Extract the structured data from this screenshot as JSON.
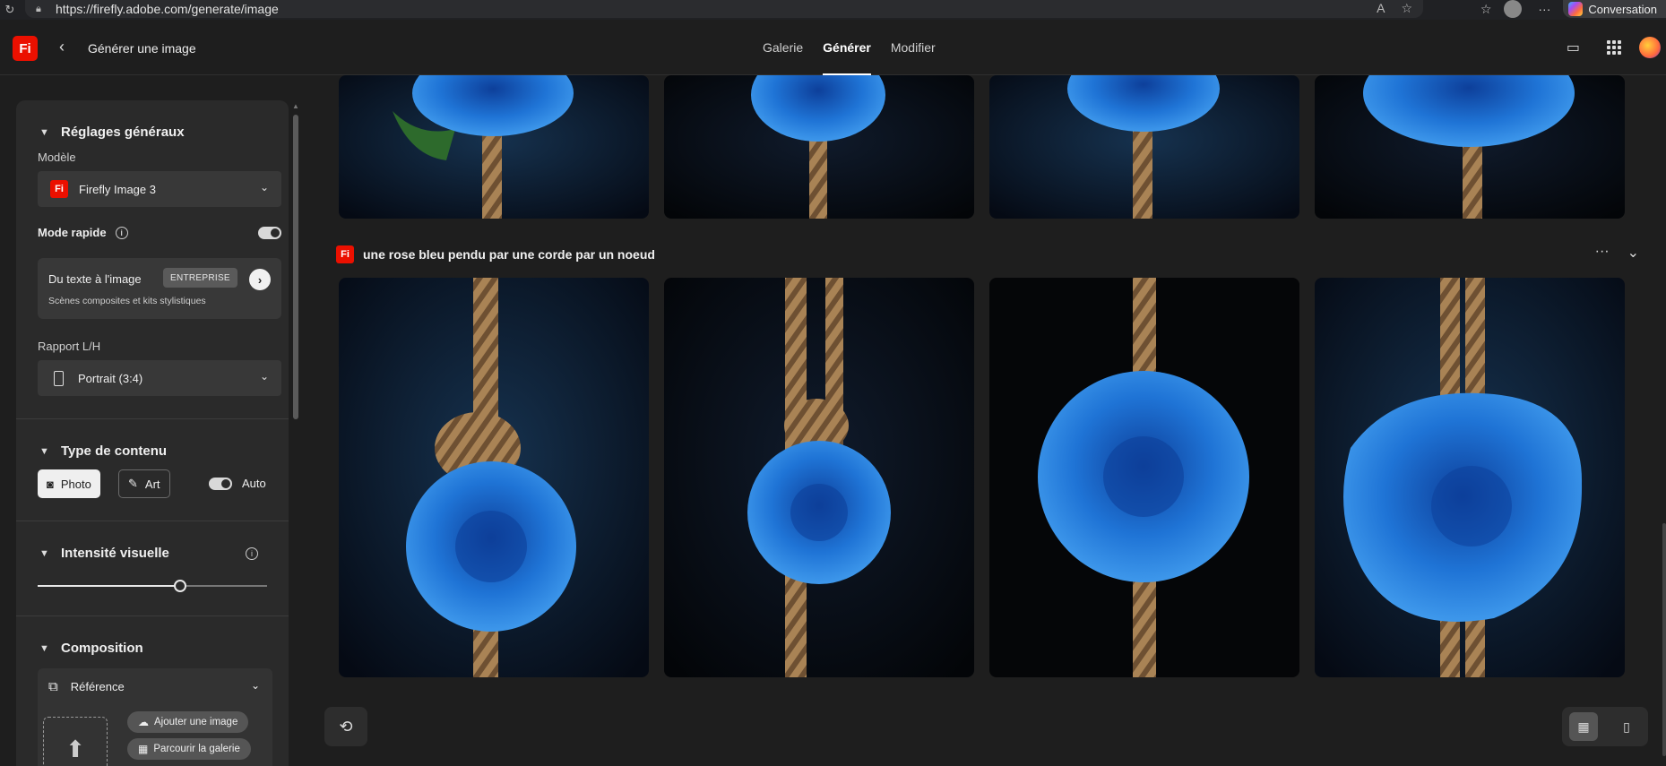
{
  "browser": {
    "url": "https://firefly.adobe.com/generate/image",
    "copilot_label": "Conversation"
  },
  "header": {
    "logo": "Fi",
    "title": "Générer une image",
    "tabs": [
      {
        "label": "Galerie",
        "active": false
      },
      {
        "label": "Générer",
        "active": true
      },
      {
        "label": "Modifier",
        "active": false
      }
    ]
  },
  "sidebar": {
    "general": {
      "title": "Réglages généraux",
      "model_label": "Modèle",
      "model_value": "Firefly Image 3",
      "model_icon_text": "Fi",
      "fast_mode_label": "Mode rapide",
      "fast_mode_on": true
    },
    "text_to_image": {
      "title": "Du texte à l'image",
      "badge": "ENTREPRISE",
      "subtitle": "Scènes composites et kits stylistiques"
    },
    "aspect": {
      "label": "Rapport L/H",
      "value": "Portrait (3:4)"
    },
    "content_type": {
      "title": "Type de contenu",
      "options": [
        {
          "label": "Photo",
          "selected": true
        },
        {
          "label": "Art",
          "selected": false
        }
      ],
      "auto_label": "Auto",
      "auto_on": true
    },
    "visual_intensity": {
      "title": "Intensité visuelle",
      "value_fraction": 0.62
    },
    "composition": {
      "title": "Composition",
      "reference_label": "Référence",
      "upload_label": "Ajouter une image",
      "browse_label": "Parcourir la galerie"
    }
  },
  "main": {
    "prompt": "une rose bleu pendu par une corde par un noeud",
    "prompt_icon_text": "Fi"
  },
  "colors": {
    "accent": "#eb1000",
    "rose": "#1f74d6",
    "rope": "#a98355",
    "bg": "#1e1e1e"
  }
}
